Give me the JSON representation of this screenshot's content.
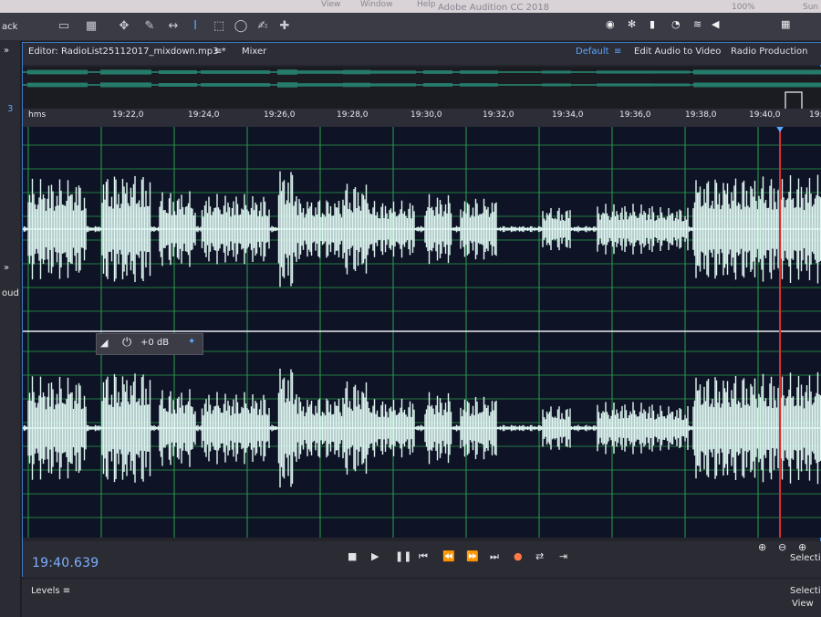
{
  "menubar": {
    "items": [
      "View",
      "Window",
      "Help"
    ],
    "window_title": "Adobe Audition CC 2018",
    "right": {
      "battery": "100%",
      "user": "Sun"
    }
  },
  "left_panel": {
    "top_label": "ack",
    "mid_label": "3",
    "lower_label": "oud"
  },
  "editor": {
    "tab_label": "Editor: RadioList25112017_mixdown.mp3 *",
    "mixer_label": "Mixer",
    "workspaces": [
      "Default",
      "Edit Audio to Video",
      "Radio Production"
    ]
  },
  "ruler": {
    "unit": "hms",
    "labels": [
      "19:22,0",
      "19:24,0",
      "19:26,0",
      "19:28,0",
      "19:30,0",
      "19:32,0",
      "19:34,0",
      "19:36,0",
      "19:38,0",
      "19:40,0",
      "19:"
    ]
  },
  "gain_hud": {
    "value": "+0 dB"
  },
  "transport": {
    "time": "19:40.639"
  },
  "panels": {
    "levels_label": "Levels",
    "selection_label": "Selection",
    "view_label": "View"
  },
  "colors": {
    "waveform": "#dff7f2",
    "waveform_edge": "#2dbb9b",
    "grid": "#2aa24a",
    "playhead": "#e02b2b",
    "accent": "#3d7cc7"
  }
}
